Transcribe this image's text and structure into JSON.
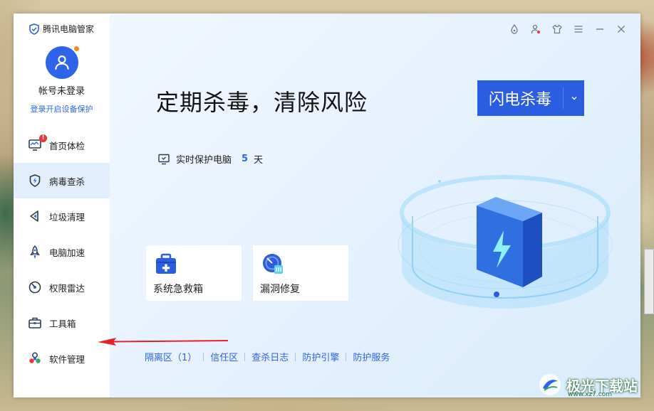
{
  "app": {
    "title": "腾讯电脑管家"
  },
  "account": {
    "name": "帐号未登录",
    "login_prompt": "登录开启设备保护"
  },
  "sidebar": {
    "items": [
      {
        "label": "首页体检",
        "icon": "monitor-icon",
        "badge": "!"
      },
      {
        "label": "病毒查杀",
        "icon": "shield-bolt-icon",
        "active": true
      },
      {
        "label": "垃圾清理",
        "icon": "broom-icon"
      },
      {
        "label": "电脑加速",
        "icon": "rocket-icon"
      },
      {
        "label": "权限雷达",
        "icon": "radar-icon"
      },
      {
        "label": "工具箱",
        "icon": "toolbox-icon"
      },
      {
        "label": "软件管理",
        "icon": "apps-icon"
      }
    ]
  },
  "window_controls": [
    "drop-icon",
    "user-alert-icon",
    "shirt-icon",
    "menu-icon",
    "minimize-icon",
    "close-icon"
  ],
  "main": {
    "headline": "定期杀毒，清除风险",
    "scan_button": "闪电杀毒",
    "protection": {
      "label": "实时保护电脑",
      "days": "5",
      "unit": "天"
    },
    "tools": [
      {
        "label": "系统急救箱",
        "icon": "first-aid-kit-icon"
      },
      {
        "label": "漏洞修复",
        "icon": "patch-icon"
      }
    ],
    "links": [
      "隔离区（1）",
      "信任区",
      "查杀日志",
      "防护引擎",
      "防护服务"
    ]
  },
  "watermark": {
    "text": "极光下载站",
    "sub": "www.xz7.com"
  },
  "colors": {
    "accent": "#2e64e8",
    "button": "#2b5de0",
    "badge": "#e8363a",
    "arrow": "#e8202a"
  }
}
